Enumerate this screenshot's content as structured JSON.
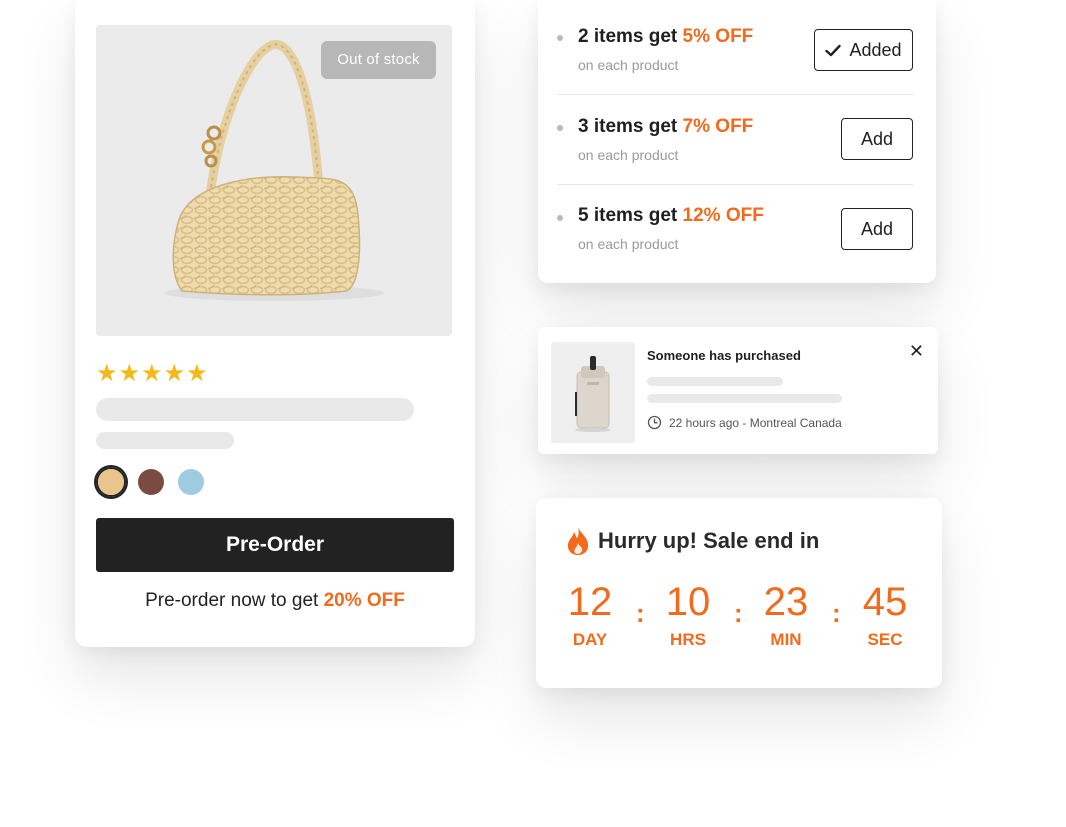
{
  "product": {
    "badge": "Out of stock",
    "rating_stars": 5,
    "swatches": [
      {
        "name": "beige",
        "color": "#e9c58d",
        "selected": true
      },
      {
        "name": "brown",
        "color": "#7b4b43",
        "selected": false
      },
      {
        "name": "light-blue",
        "color": "#9ecbe0",
        "selected": false
      }
    ],
    "button_label": "Pre-Order",
    "note_prefix": "Pre-order now to get ",
    "note_highlight": "20% OFF"
  },
  "tiers": [
    {
      "title_prefix": "2 items get ",
      "title_highlight": "5% OFF",
      "subtitle": "on each product",
      "button_label": "Added",
      "added": true
    },
    {
      "title_prefix": "3 items get ",
      "title_highlight": "7% OFF",
      "subtitle": "on each product",
      "button_label": "Add",
      "added": false
    },
    {
      "title_prefix": "5 items get ",
      "title_highlight": "12% OFF",
      "subtitle": "on each product",
      "button_label": "Add",
      "added": false
    }
  ],
  "notification": {
    "title": "Someone has purchased",
    "meta": "22 hours ago - Montreal Canada"
  },
  "countdown": {
    "title": "Hurry up! Sale end in",
    "units": [
      {
        "value": "12",
        "label": "DAY"
      },
      {
        "value": "10",
        "label": "HRS"
      },
      {
        "value": "23",
        "label": "MIN"
      },
      {
        "value": "45",
        "label": "SEC"
      }
    ],
    "separator": ":"
  },
  "colors": {
    "accent": "#f26a1b",
    "dark": "#222222",
    "star": "#f6b819"
  }
}
